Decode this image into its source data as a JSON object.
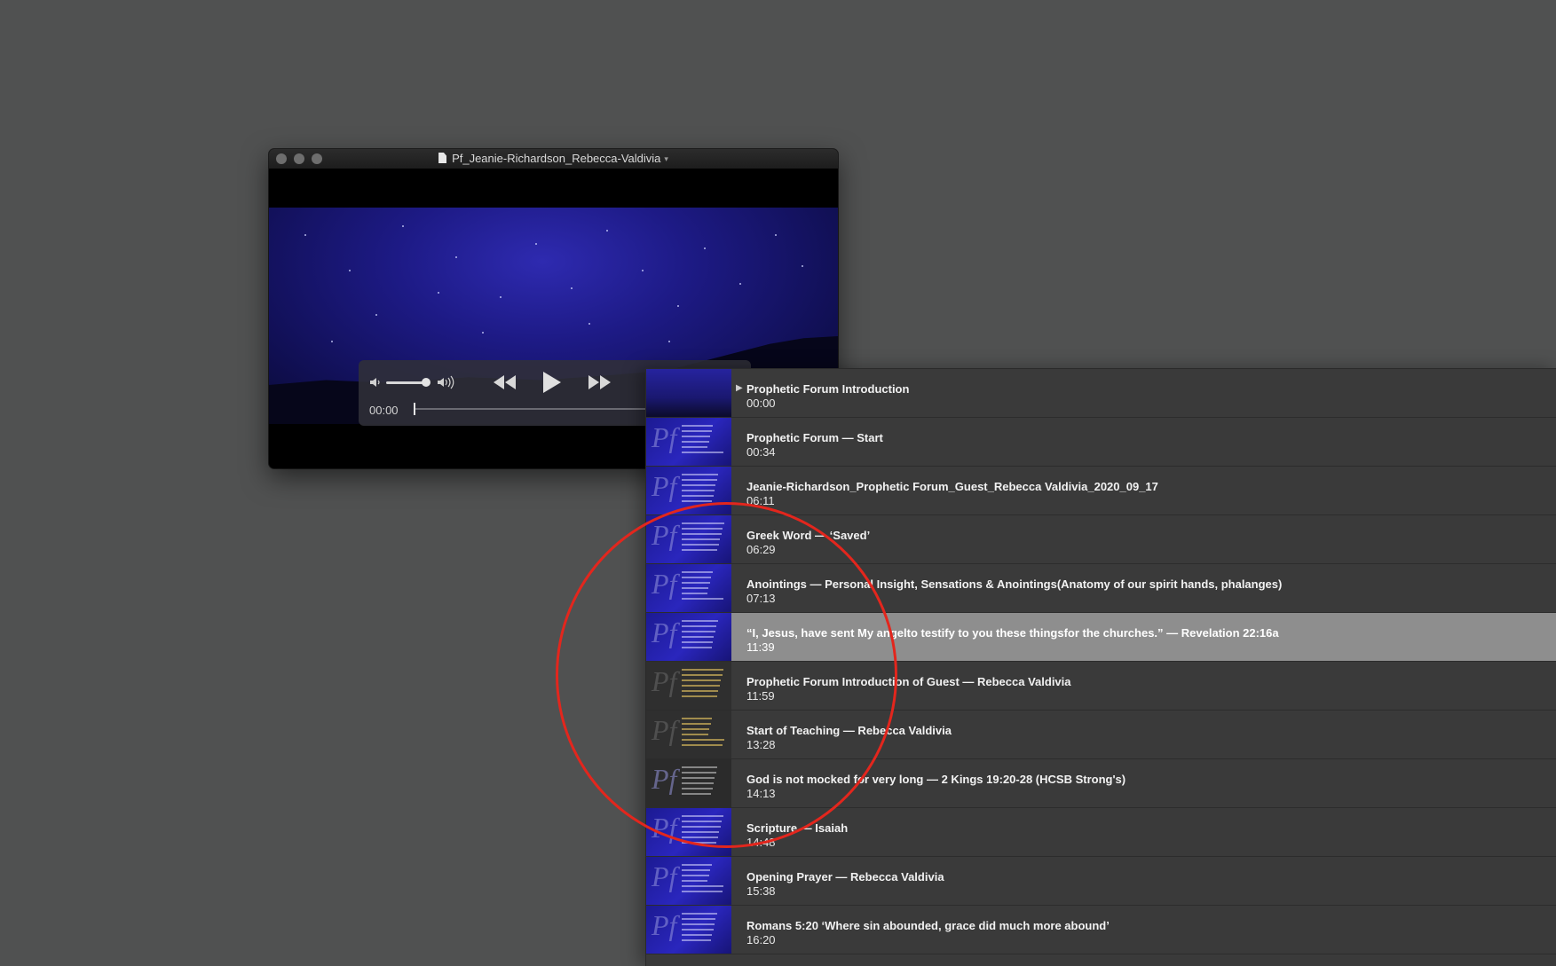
{
  "window": {
    "title": "Pf_Jeanie-Richardson_Rebecca-Valdivia"
  },
  "controls": {
    "current_time": "00:00",
    "volume_level": 0.85,
    "progress": 0.0
  },
  "chapters": [
    {
      "title": "Prophetic Forum Introduction",
      "time": "00:00",
      "playing": true,
      "thumb": "night"
    },
    {
      "title": "Prophetic Forum — Start",
      "time": "00:34",
      "thumb": "blue"
    },
    {
      "title": "Jeanie-Richardson_Prophetic Forum_Guest_Rebecca Valdivia_2020_09_17",
      "time": "06:11",
      "thumb": "blue"
    },
    {
      "title": "Greek Word — ‘Saved’",
      "time": "06:29",
      "thumb": "blue"
    },
    {
      "title": "Anointings — Personal Insight, Sensations & Anointings(Anatomy of our spirit hands, phalanges)",
      "time": "07:13",
      "thumb": "blue"
    },
    {
      "title": "“I, Jesus, have sent My angelto testify to you these thingsfor the churches.” — Revelation 22:16a",
      "time": "11:39",
      "selected": true,
      "thumb": "blue"
    },
    {
      "title": "Prophetic Forum Introduction of Guest — Rebecca Valdivia",
      "time": "11:59",
      "thumb": "dark"
    },
    {
      "title": "Start of Teaching — Rebecca Valdivia",
      "time": "13:28",
      "thumb": "dark"
    },
    {
      "title": "God is not mocked for very long — 2 Kings 19:20-28 (HCSB Strong's)",
      "time": "14:13",
      "thumb": "black"
    },
    {
      "title": "Scripture — Isaiah",
      "time": "14:48",
      "thumb": "blue"
    },
    {
      "title": "Opening Prayer — Rebecca Valdivia",
      "time": "15:38",
      "thumb": "blue"
    },
    {
      "title": "Romans 5:20 ‘Where sin abounded, grace did much more abound’",
      "time": "16:20",
      "thumb": "blue"
    }
  ],
  "annotation": {
    "color": "#e3261d"
  }
}
